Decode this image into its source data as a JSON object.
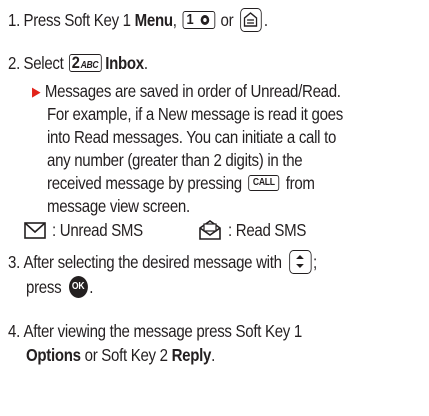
{
  "steps": [
    {
      "num": "1.",
      "pre": "Press Soft Key 1 ",
      "bold": "Menu",
      "mid": ",",
      "key1_label": "1",
      "or_text": "or",
      "end": "."
    },
    {
      "num": "2.",
      "pre": "Select",
      "key2_label": "2",
      "key2_letters": "ABC",
      "bold": "Inbox",
      "end": "."
    },
    {
      "num": "3.",
      "line1_pre": "After selecting the desired message with",
      "line1_end": ";",
      "line2_pre": "press",
      "ok_label": "OK",
      "line2_end": "."
    },
    {
      "num": "4.",
      "line1": "After viewing the message press Soft Key 1",
      "line2_bold1": "Options",
      "line2_mid": " or Soft Key 2 ",
      "line2_bold2": "Reply",
      "line2_end": "."
    }
  ],
  "note": {
    "arrow": "▶",
    "line1": "Messages are saved in order of Unread/Read.",
    "line2": "For example, if a New message is read it goes",
    "line3": "into Read messages. You can initiate a call to",
    "line4": "any number (greater than 2 digits) in the",
    "line5_pre": "received message by pressing",
    "call_label": "CALL",
    "line5_post": "from",
    "line6": "message view screen."
  },
  "legend": {
    "unread": ": Unread SMS",
    "read": ": Read SMS"
  },
  "colors": {
    "text": "#231f20",
    "arrow": "#e2231a"
  }
}
